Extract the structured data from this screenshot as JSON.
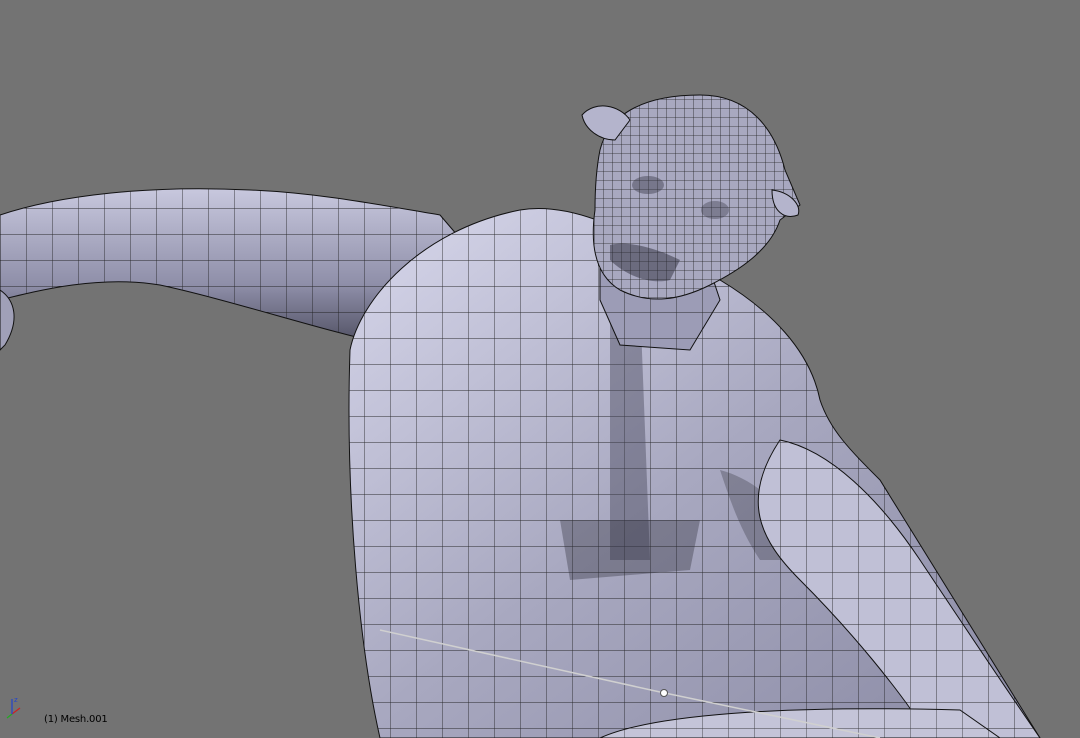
{
  "viewport": {
    "background": "#737373",
    "mesh_fill": "#b8b8d0",
    "mesh_wire": "#000000",
    "object_label": "(1) Mesh.001"
  },
  "axis_gizmo": {
    "z_label": "z",
    "x_color": "#cc2222",
    "y_color": "#22aa22",
    "z_color": "#2244cc"
  }
}
